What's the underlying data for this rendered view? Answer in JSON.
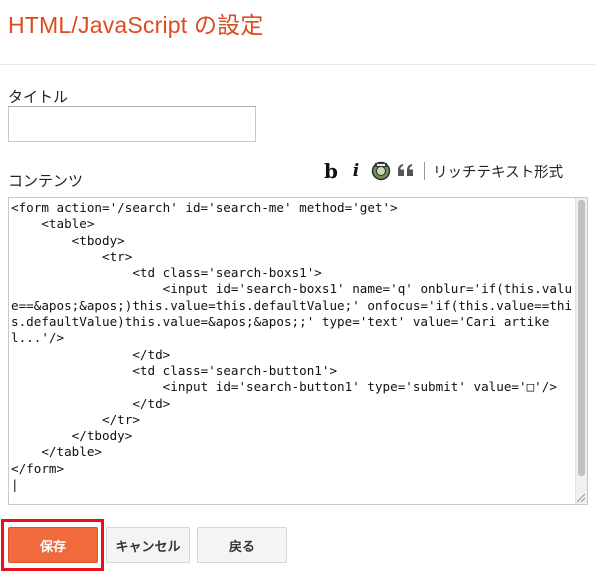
{
  "dialog": {
    "title": "HTML/JavaScript の設定"
  },
  "form": {
    "title_label": "タイトル",
    "title_value": "",
    "content_label": "コンテンツ"
  },
  "toolbar": {
    "bold_glyph": "b",
    "italic_glyph": "i",
    "rich_text_label": "リッチテキスト形式"
  },
  "editor": {
    "content": "<form action='/search' id='search-me' method='get'>\n    <table>\n        <tbody>\n            <tr>\n                <td class='search-boxs1'>\n                    <input id='search-boxs1' name='q' onblur='if(this.value==&apos;&apos;)this.value=this.defaultValue;' onfocus='if(this.value==this.defaultValue)this.value=&apos;&apos;;' type='text' value='Cari artikel...'/>\n                </td>\n                <td class='search-button1'>\n                    <input id='search-button1' type='submit' value='□'/>\n                </td>\n            </tr>\n        </tbody>\n    </table>\n</form>\n|"
  },
  "buttons": {
    "save": "保存",
    "cancel": "キャンセル",
    "back": "戻る"
  },
  "colors": {
    "title": "#dd4b1e",
    "save_button": "#f06a3c",
    "highlight": "#e8101a"
  }
}
